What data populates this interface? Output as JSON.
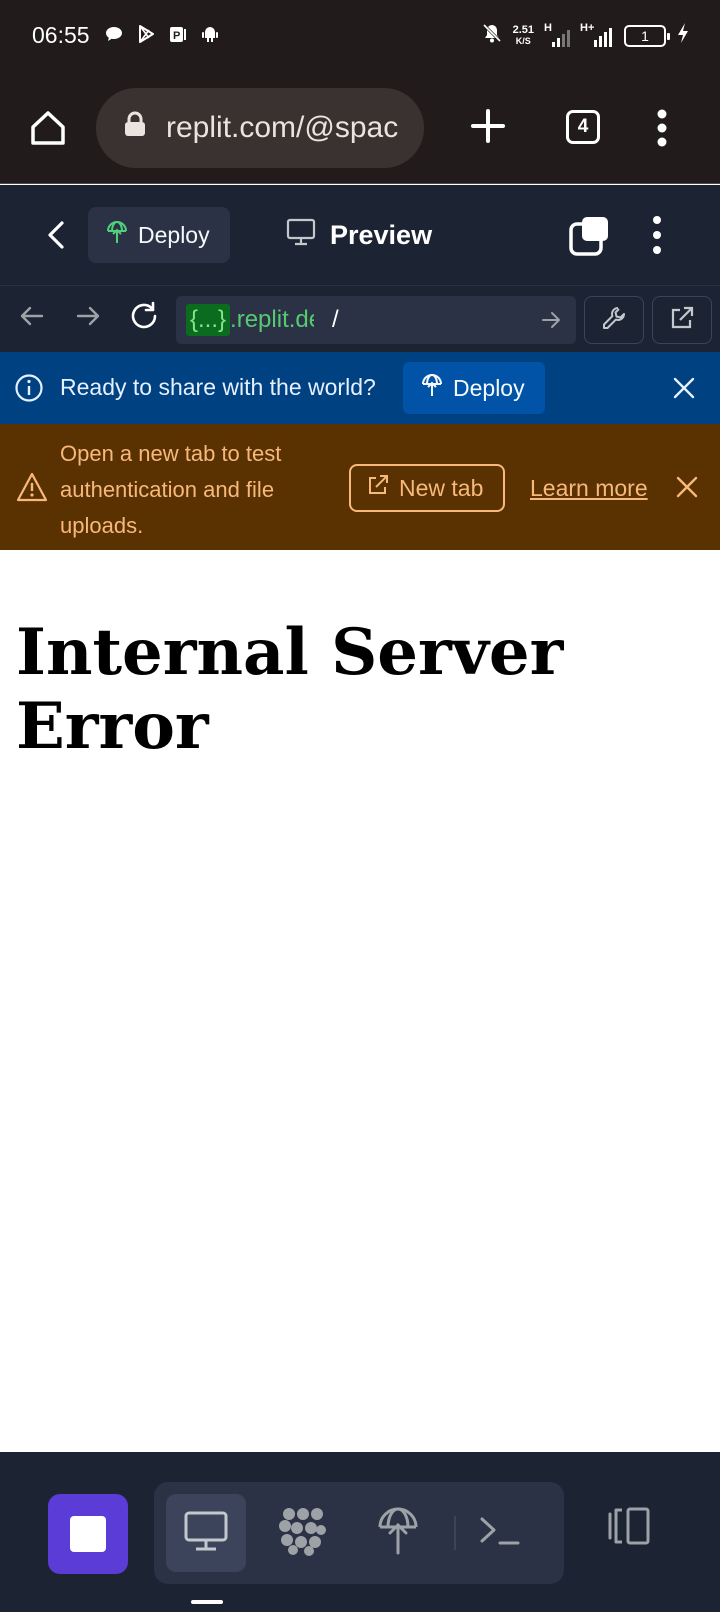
{
  "status_bar": {
    "time": "06:55",
    "net_speed_value": "2.51",
    "net_speed_unit": "K/S",
    "signal1_label": "H",
    "signal2_label": "H+",
    "battery_level": "1",
    "icons": [
      "chat-bubble-icon",
      "play-store-icon",
      "parking-icon",
      "android-icon",
      "bell-off-icon",
      "signal-icon",
      "charging-icon"
    ]
  },
  "browser": {
    "url": "replit.com/@spac",
    "tab_count": "4"
  },
  "replit_header": {
    "deploy_label": "Deploy",
    "preview_label": "Preview"
  },
  "webview_nav": {
    "host_token": "{...}",
    "host": ".replit.dev",
    "path": "/"
  },
  "deploy_banner": {
    "message": "Ready to share with the world?",
    "button_label": "Deploy"
  },
  "warning_banner": {
    "message": "Open a new tab to test authentication and file uploads.",
    "new_tab_label": "New tab",
    "learn_more_label": "Learn more"
  },
  "page": {
    "heading": "Internal Server Error"
  },
  "colors": {
    "browser_chrome": "#211c1b",
    "replit_bg": "#1c2333",
    "deploy_banner": "#004182",
    "warning_banner": "#5a3202",
    "warning_text": "#f7b87b",
    "stop_button": "#5b3cd6"
  }
}
